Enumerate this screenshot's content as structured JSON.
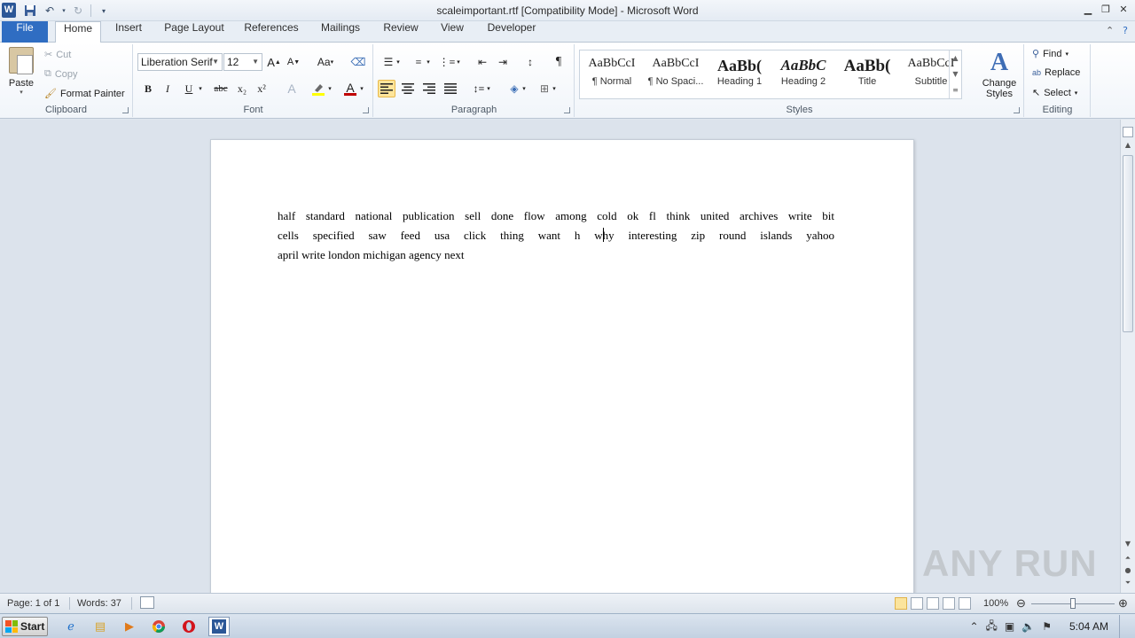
{
  "window": {
    "title": "scaleimportant.rtf [Compatibility Mode]  -  Microsoft Word",
    "app_icon": "W"
  },
  "tabs": {
    "file": "File",
    "items": [
      "Home",
      "Insert",
      "Page Layout",
      "References",
      "Mailings",
      "Review",
      "View",
      "Developer"
    ],
    "active": "Home"
  },
  "ribbon": {
    "clipboard": {
      "label": "Clipboard",
      "paste": "Paste",
      "cut": "Cut",
      "copy": "Copy",
      "format_painter": "Format Painter"
    },
    "font": {
      "label": "Font",
      "font_name": "Liberation Serif",
      "font_size": "12",
      "bold": "B",
      "italic": "I",
      "underline": "U",
      "strike": "abc",
      "subscript": "x₂",
      "superscript": "x²",
      "grow": "A",
      "shrink": "A",
      "change_case": "Aa",
      "font_color_hex": "#c00000",
      "highlight_hex": "#ffff00"
    },
    "paragraph": {
      "label": "Paragraph",
      "pilcrow": "¶"
    },
    "styles": {
      "label": "Styles",
      "items": [
        {
          "sample": "AaBbCcI",
          "name": "¶ Normal"
        },
        {
          "sample": "AaBbCcI",
          "name": "¶ No Spaci..."
        },
        {
          "sample": "AaBb(",
          "name": "Heading 1"
        },
        {
          "sample": "AaBbC",
          "name": "Heading 2"
        },
        {
          "sample": "AaBb(",
          "name": "Title"
        },
        {
          "sample": "AaBbCcI",
          "name": "Subtitle"
        }
      ],
      "change_styles": "Change Styles"
    },
    "editing": {
      "label": "Editing",
      "find": "Find",
      "replace": "Replace",
      "select": "Select"
    }
  },
  "document": {
    "lines": [
      "half  standard  national  publication  sell  done flow   among  cold ok fl think  united  archives  write  bit",
      "cells    specified     saw feed     usa click  thing    want h why    interesting  zip    round islands  yahoo",
      "april  write    london  michigan     agency  next"
    ]
  },
  "status": {
    "page": "Page: 1 of 1",
    "words": "Words: 37",
    "zoom": "100%",
    "zoom_percent": 100
  },
  "taskbar": {
    "start": "Start",
    "time": "5:04 AM"
  },
  "watermark": "ANY RUN"
}
